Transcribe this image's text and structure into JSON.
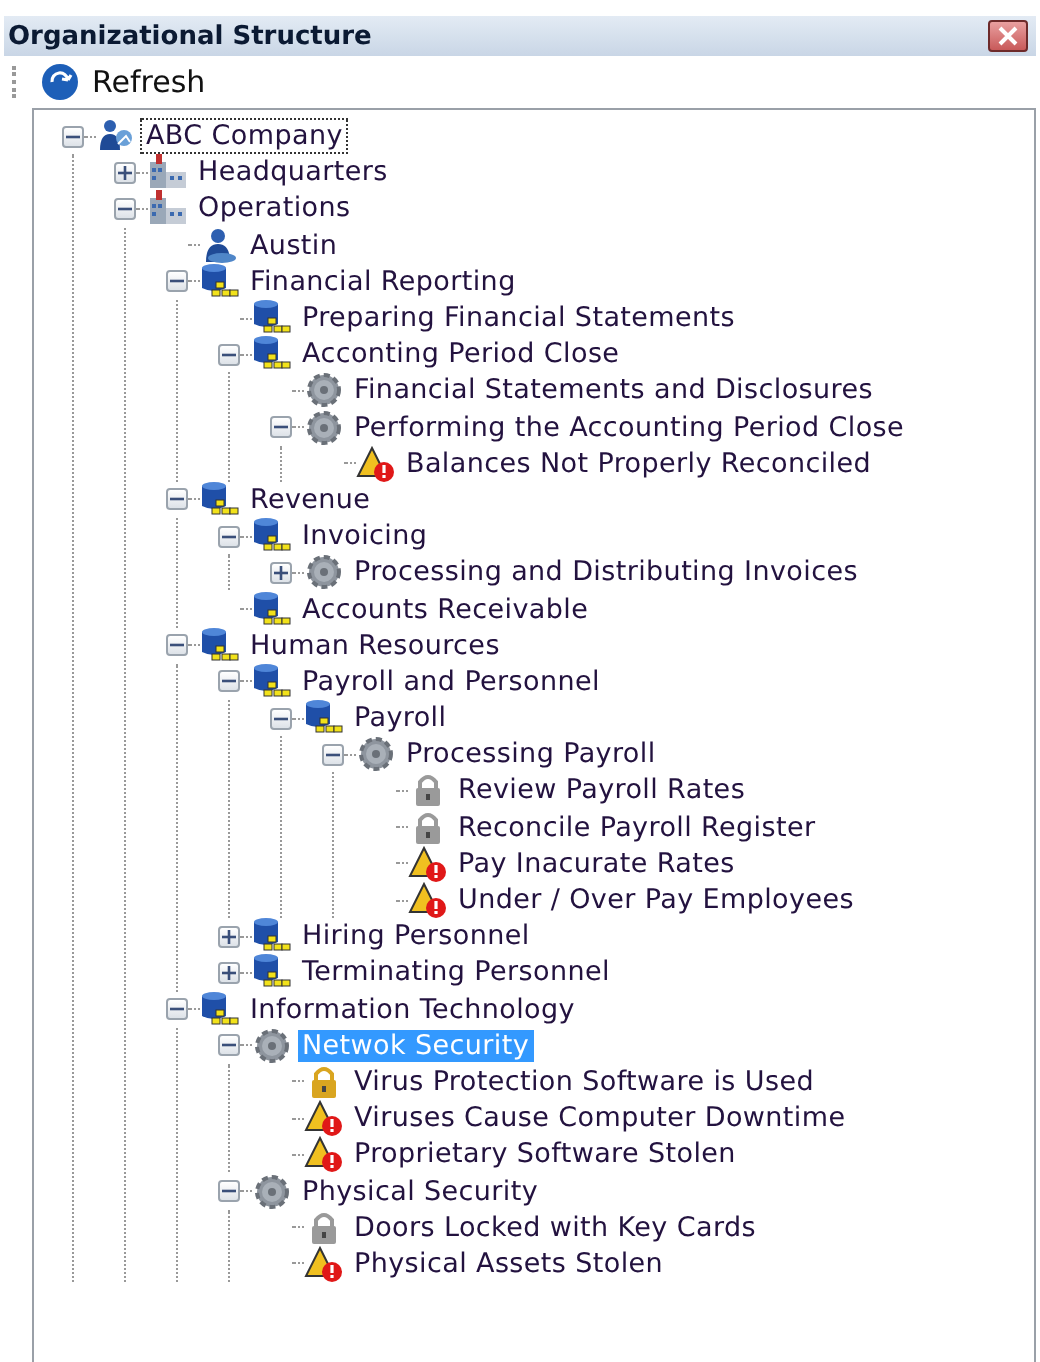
{
  "window": {
    "title": "Organizational Structure"
  },
  "toolbar": {
    "buttons": [
      {
        "label": "Refresh"
      }
    ]
  },
  "tree": [
    {
      "label": "ABC Company",
      "kind": "company",
      "expanded": true,
      "selected": false,
      "focused": true,
      "children": [
        {
          "label": "Headquarters",
          "kind": "site",
          "expanded": false,
          "selected": false
        },
        {
          "label": "Operations",
          "kind": "site",
          "expanded": true,
          "selected": false,
          "children": [
            {
              "label": "Austin",
              "kind": "location",
              "selected": false
            },
            {
              "label": "Financial Reporting",
              "kind": "process",
              "expanded": true,
              "selected": false,
              "children": [
                {
                  "label": "Preparing Financial Statements",
                  "kind": "process",
                  "selected": false
                },
                {
                  "label": "Acconting Period Close",
                  "kind": "process",
                  "expanded": true,
                  "selected": false,
                  "children": [
                    {
                      "label": "Financial Statements and Disclosures",
                      "kind": "activity",
                      "selected": false
                    },
                    {
                      "label": "Performing the Accounting Period Close",
                      "kind": "activity",
                      "expanded": true,
                      "selected": false,
                      "children": [
                        {
                          "label": "Balances Not Properly Reconciled",
                          "kind": "risk",
                          "selected": false
                        }
                      ]
                    }
                  ]
                }
              ]
            },
            {
              "label": "Revenue",
              "kind": "process",
              "expanded": true,
              "selected": false,
              "children": [
                {
                  "label": "Invoicing",
                  "kind": "process",
                  "expanded": true,
                  "selected": false,
                  "children": [
                    {
                      "label": "Processing and Distributing Invoices",
                      "kind": "activity",
                      "expanded": false,
                      "selected": false
                    }
                  ]
                },
                {
                  "label": "Accounts Receivable",
                  "kind": "process",
                  "selected": false
                }
              ]
            },
            {
              "label": "Human Resources",
              "kind": "process",
              "expanded": true,
              "selected": false,
              "children": [
                {
                  "label": "Payroll and Personnel",
                  "kind": "process",
                  "expanded": true,
                  "selected": false,
                  "children": [
                    {
                      "label": "Payroll",
                      "kind": "process",
                      "expanded": true,
                      "selected": false,
                      "children": [
                        {
                          "label": "Processing Payroll",
                          "kind": "activity",
                          "expanded": true,
                          "selected": false,
                          "children": [
                            {
                              "label": "Review Payroll Rates",
                              "kind": "control",
                              "color": "#9a9a9a",
                              "selected": false
                            },
                            {
                              "label": "Reconcile Payroll Register",
                              "kind": "control",
                              "color": "#9a9a9a",
                              "selected": false
                            },
                            {
                              "label": "Pay Inacurate Rates",
                              "kind": "risk",
                              "selected": false
                            },
                            {
                              "label": "Under / Over Pay Employees",
                              "kind": "risk",
                              "selected": false
                            }
                          ]
                        }
                      ]
                    }
                  ]
                },
                {
                  "label": "Hiring Personnel",
                  "kind": "process",
                  "expanded": false,
                  "selected": false
                },
                {
                  "label": "Terminating Personnel",
                  "kind": "process",
                  "expanded": false,
                  "selected": false
                }
              ]
            },
            {
              "label": "Information Technology",
              "kind": "process",
              "expanded": true,
              "selected": false,
              "children": [
                {
                  "label": "Netwok Security",
                  "kind": "activity",
                  "expanded": true,
                  "selected": true,
                  "children": [
                    {
                      "label": "Virus Protection Software is Used",
                      "kind": "control",
                      "color": "#d9a520",
                      "selected": false
                    },
                    {
                      "label": "Viruses Cause Computer Downtime",
                      "kind": "risk",
                      "selected": false
                    },
                    {
                      "label": "Proprietary Software Stolen",
                      "kind": "risk",
                      "selected": false
                    }
                  ]
                },
                {
                  "label": "Physical Security",
                  "kind": "activity",
                  "expanded": true,
                  "selected": false,
                  "children": [
                    {
                      "label": "Doors Locked with Key Cards",
                      "kind": "control",
                      "color": "#9a9a9a",
                      "selected": false
                    },
                    {
                      "label": "Physical Assets Stolen",
                      "kind": "risk",
                      "selected": false
                    }
                  ]
                }
              ]
            }
          ]
        }
      ]
    }
  ]
}
